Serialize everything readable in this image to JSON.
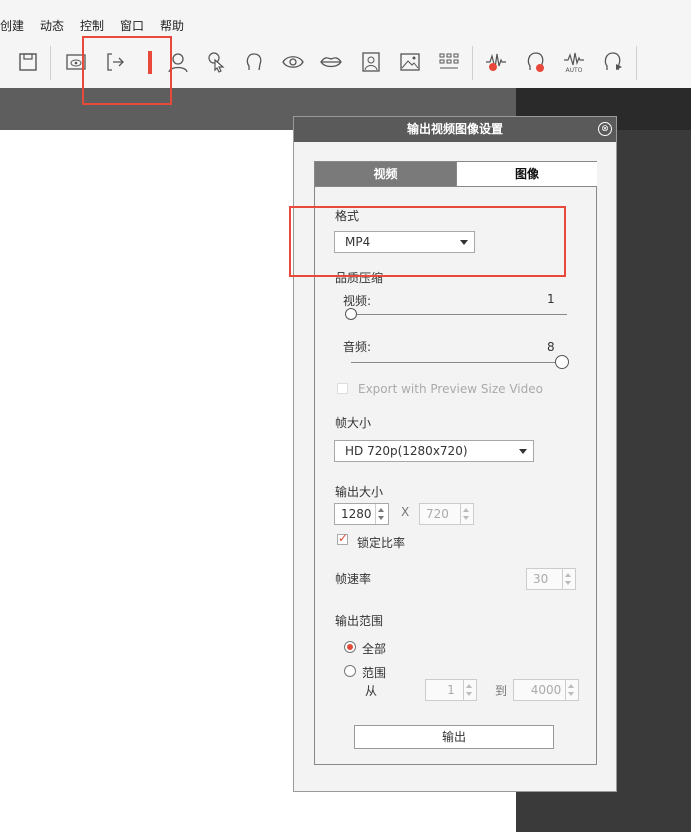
{
  "menu": {
    "items": [
      "创建",
      "动态",
      "控制",
      "窗口",
      "帮助"
    ]
  },
  "toolbar": {
    "icons": [
      "save-icon",
      "view-icon",
      "exit-icon",
      "marker-icon",
      "person-icon",
      "pointer-icon",
      "head-icon",
      "eye-icon",
      "lips-icon",
      "portrait-icon",
      "image-icon",
      "grid-icon",
      "audio-record-icon",
      "face-record-icon",
      "auto-wave-icon",
      "face-play-icon"
    ],
    "auto_label": "AUTO"
  },
  "dialog": {
    "title": "输出视频图像设置",
    "close": "⊗",
    "tabs": [
      {
        "label": "视频",
        "active": true
      },
      {
        "label": "图像",
        "active": false
      }
    ],
    "format": {
      "label": "格式",
      "value": "MP4"
    },
    "quality": {
      "label": "品质压缩",
      "video": {
        "label": "视频:",
        "value": "1"
      },
      "audio": {
        "label": "音频:",
        "value": "8"
      }
    },
    "preview_size": {
      "label": "Export with Preview Size Video",
      "checked": false,
      "enabled": false
    },
    "frame_size": {
      "label": "帧大小",
      "value": "HD 720p(1280x720)"
    },
    "output_size": {
      "label": "输出大小",
      "width": "1280",
      "separator": "X",
      "height": "720"
    },
    "lock_ratio": {
      "label": "锁定比率",
      "checked": true
    },
    "frame_rate": {
      "label": "帧速率",
      "value": "30"
    },
    "range": {
      "label": "输出范围",
      "all": "全部",
      "custom": "范围",
      "from_label": "从",
      "from": "1",
      "to_label": "到",
      "to": "4000",
      "selected": "all"
    },
    "export_button": "输出"
  },
  "colors": {
    "accent": "#e8493b",
    "title_bar": "#5a5a5a",
    "tab_active": "#7a7a7a"
  }
}
